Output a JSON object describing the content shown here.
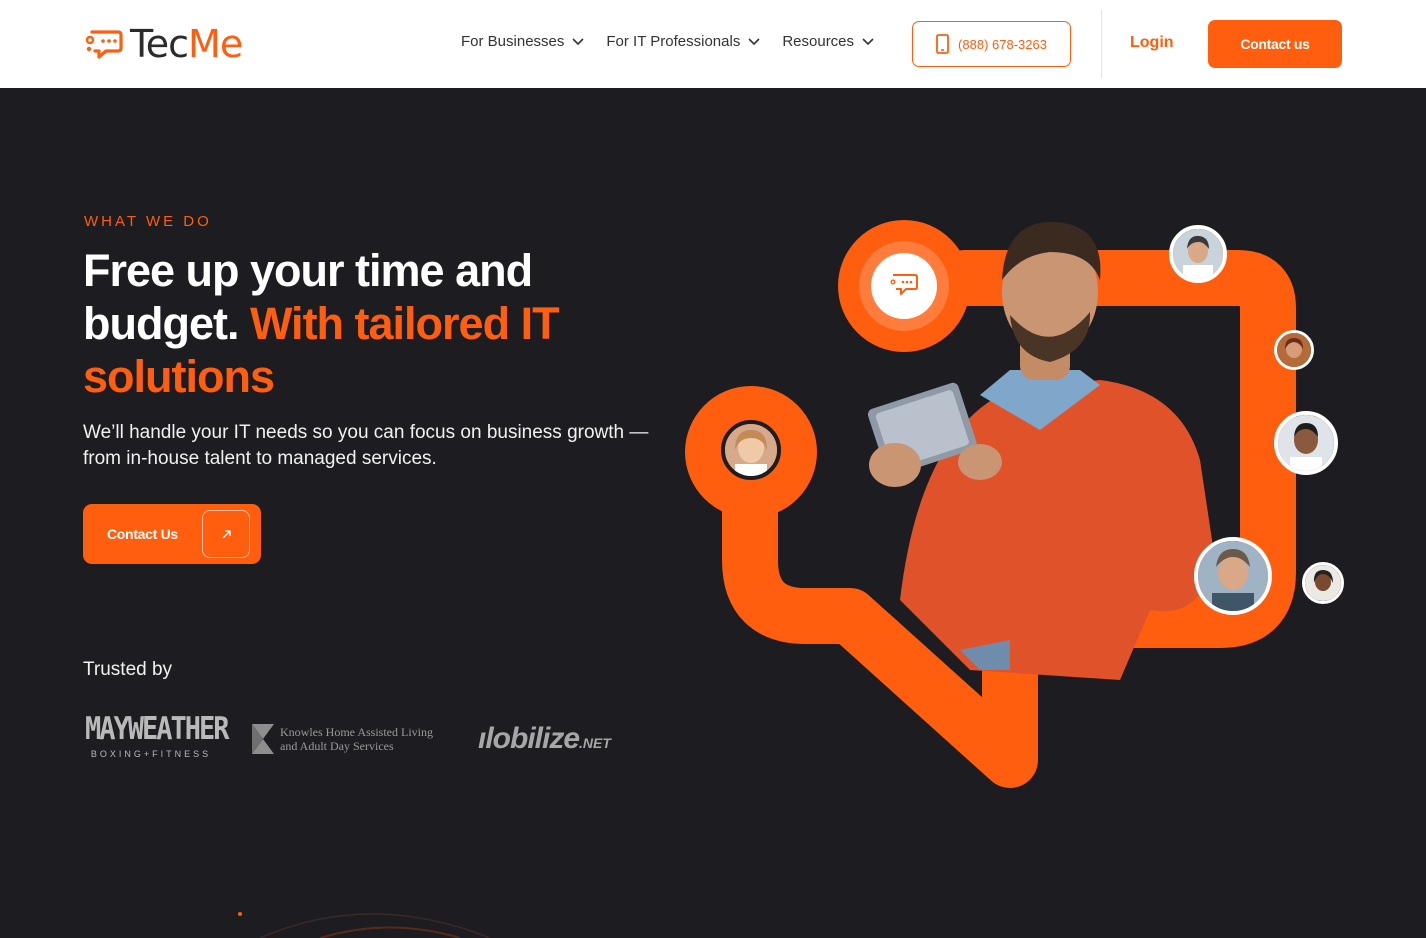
{
  "brand": {
    "logo_part1": "Tec",
    "logo_part2": "Me",
    "accent_color": "#ff5e0e",
    "background_color": "#1c1c21"
  },
  "nav": {
    "items": [
      {
        "label": "For Businesses",
        "icon": "chevron-down-icon"
      },
      {
        "label": "For IT Professionals",
        "icon": "chevron-down-icon"
      },
      {
        "label": "Resources",
        "icon": "chevron-down-icon"
      }
    ],
    "phone": "(888) 678-3263",
    "phone_icon": "phone-icon",
    "login": "Login",
    "contact": "Contact us"
  },
  "hero": {
    "eyebrow": "WHAT WE DO",
    "headline_white": "Free up your time and budget.",
    "headline_accent": "With tailored IT solutions",
    "subtitle": "We’ll handle your IT needs so you can focus on business growth — from in-house talent to managed services.",
    "cta_label": "Contact Us",
    "cta_icon": "arrow-up-right-icon",
    "trusted_label": "Trusted by"
  },
  "trusted_logos": {
    "mayweather_main": "MAYWEATHER",
    "mayweather_sub": "BOXING+FITNESS",
    "knowles_line1": "Knowles Home Assisted Living",
    "knowles_line2": "and Adult Day Services",
    "mobilize_main": "ılobilize",
    "mobilize_suffix": ".NET"
  }
}
